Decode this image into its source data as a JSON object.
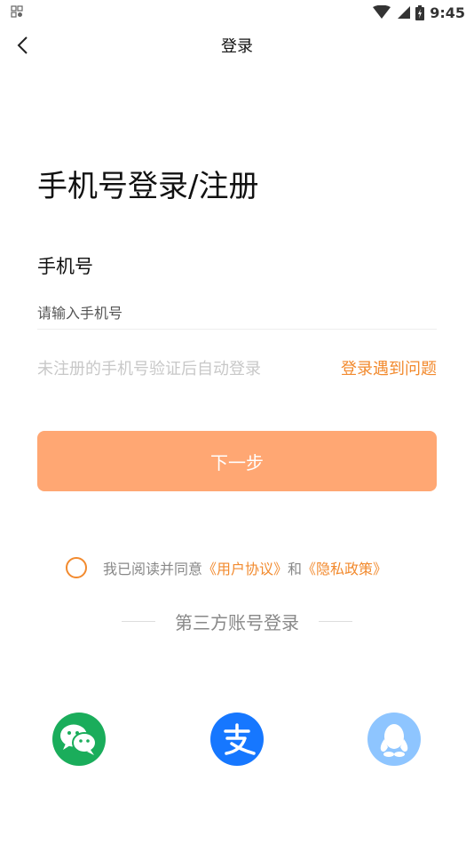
{
  "status_bar": {
    "time": "9:45",
    "icons": [
      "app-notification-icon",
      "wifi-icon",
      "signal-icon",
      "battery-icon"
    ]
  },
  "header": {
    "back_icon": "chevron-left-icon",
    "title": "登录"
  },
  "main": {
    "title": "手机号登录/注册",
    "phone_label": "手机号",
    "phone_input": {
      "value": "",
      "placeholder": "请输入手机号"
    },
    "hint": "未注册的手机号验证后自动登录",
    "problem_link": "登录遇到问题",
    "next_button": "下一步",
    "agreement": {
      "checked": false,
      "prefix": "我已阅读并同意",
      "user_agreement": "《用户协议》",
      "and": "和",
      "privacy_policy": "《隐私政策》"
    },
    "third_party_label": "第三方账号登录",
    "social_logins": [
      {
        "name": "wechat-icon",
        "color": "#1aad5b"
      },
      {
        "name": "alipay-icon",
        "color": "#1677ff"
      },
      {
        "name": "qq-icon",
        "color": "#8ec5ff"
      }
    ]
  },
  "colors": {
    "accent": "#f28a2e",
    "button_bg": "#ffa773",
    "hint_gray": "#c8c8c8"
  }
}
